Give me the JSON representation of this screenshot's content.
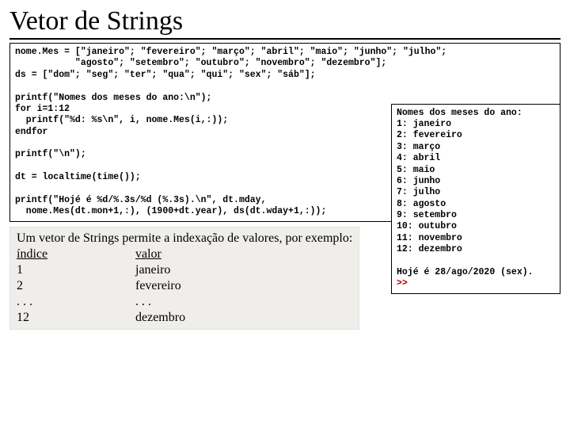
{
  "title": "Vetor de Strings",
  "code": "nome.Mes = [\"janeiro\"; \"fevereiro\"; \"março\"; \"abril\"; \"maio\"; \"junho\"; \"julho\";\n           \"agosto\"; \"setembro\"; \"outubro\"; \"novembro\"; \"dezembro\"];\nds = [\"dom\"; \"seg\"; \"ter\"; \"qua\"; \"qui\"; \"sex\"; \"sáb\"];\n\nprintf(\"Nomes dos meses do ano:\\n\");\nfor i=1:12\n  printf(\"%d: %s\\n\", i, nome.Mes(i,:));\nendfor\n\nprintf(\"\\n\");\n\ndt = localtime(time());\n\nprintf(\"Hojé é %d/%.3s/%d (%.3s).\\n\", dt.mday,\n  nome.Mes(dt.mon+1,:), (1900+dt.year), ds(dt.wday+1,:));",
  "explain": {
    "intro": "Um vetor de Strings permite a indexação de valores, por exemplo:",
    "head_index": "índice",
    "head_value": "valor",
    "rows": [
      {
        "i": "1",
        "v": "janeiro"
      },
      {
        "i": "2",
        "v": "fevereiro"
      },
      {
        "i": ". . .",
        "v": ". . ."
      },
      {
        "i": "12",
        "v": "dezembro"
      }
    ]
  },
  "output": {
    "header": "Nomes dos meses do ano:",
    "months": [
      "1: janeiro",
      "2: fevereiro",
      "3: março",
      "4: abril",
      "5: maio",
      "6: junho",
      "7: julho",
      "8: agosto",
      "9: setembro",
      "10: outubro",
      "11: novembro",
      "12: dezembro"
    ],
    "result": "Hojé é 28/ago/2020 (sex).",
    "prompt": ">>"
  }
}
